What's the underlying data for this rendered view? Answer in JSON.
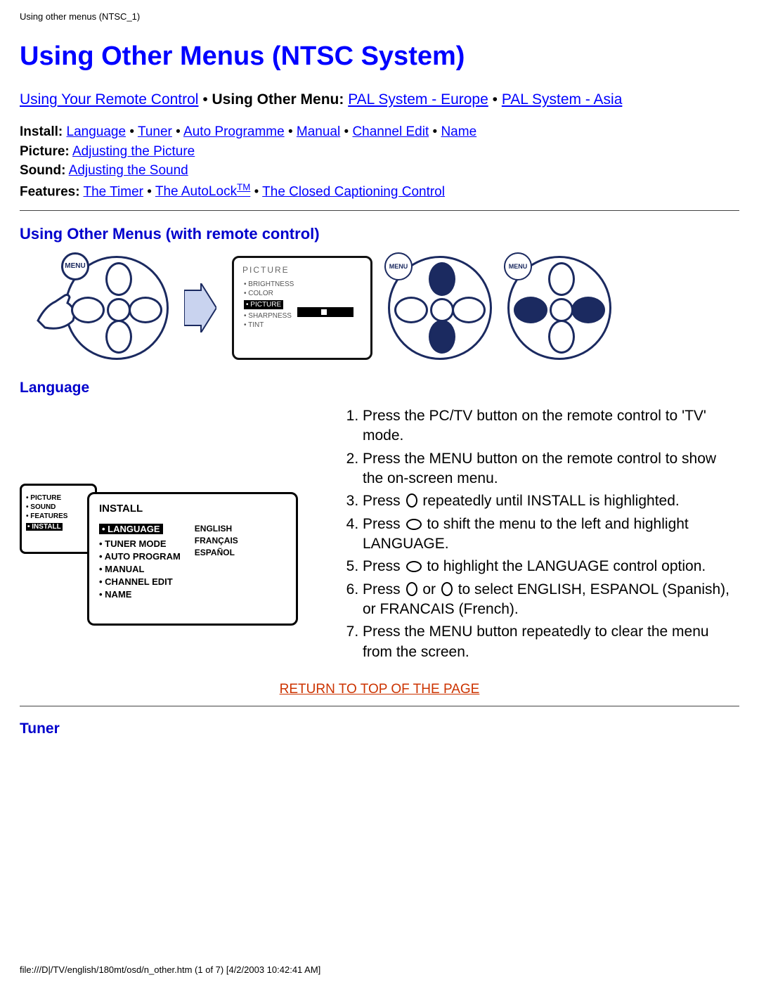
{
  "header_path": "Using other menus (NTSC_1)",
  "title": "Using Other Menus (NTSC System)",
  "topnav": {
    "remote": "Using Your Remote Control",
    "sep": " • ",
    "current_label": "Using Other Menu:",
    "pal_eu": "PAL System - Europe",
    "pal_asia": "PAL System - Asia"
  },
  "subnav": {
    "install_label": "Install:",
    "install_items": [
      "Language",
      "Tuner",
      "Auto Programme",
      "Manual",
      "Channel Edit",
      "Name"
    ],
    "picture_label": "Picture:",
    "picture_link": "Adjusting the Picture",
    "sound_label": "Sound:",
    "sound_link": "Adjusting the Sound",
    "features_label": "Features:",
    "features_timer": "The Timer",
    "features_autolock_pre": "The AutoLock",
    "features_autolock_tm": "TM",
    "features_cc": "The Closed Captioning Control"
  },
  "section_remote": "Using Other Menus (with remote control)",
  "osd": {
    "title": "PICTURE",
    "items": [
      "BRIGHTNESS",
      "COLOR",
      "PICTURE",
      "SHARPNESS",
      "TINT"
    ]
  },
  "menu_badge": "MENU",
  "section_language": "Language",
  "install_panel": {
    "small_items": [
      "PICTURE",
      "SOUND",
      "FEATURES",
      "INSTALL"
    ],
    "title": "INSTALL",
    "col1": [
      "LANGUAGE",
      "TUNER MODE",
      "AUTO PROGRAM",
      "MANUAL",
      "CHANNEL EDIT",
      "NAME"
    ],
    "col2": [
      "ENGLISH",
      "FRANÇAIS",
      "ESPAÑOL"
    ]
  },
  "steps": [
    "Press the PC/TV button on the remote control to 'TV' mode.",
    "Press the MENU button on the remote control to show the on-screen menu.",
    {
      "pre": "Press ",
      "icon": "v",
      "post": " repeatedly until INSTALL is highlighted."
    },
    {
      "pre": "Press ",
      "icon": "h",
      "post": " to shift the menu to the left and highlight LANGUAGE."
    },
    {
      "pre": "Press ",
      "icon": "h",
      "post": " to highlight the LANGUAGE control option."
    },
    {
      "pre": "Press ",
      "icon": "v",
      "mid": " or ",
      "icon2": "v",
      "post": " to select ENGLISH, ESPANOL (Spanish), or FRANCAIS (French)."
    },
    "Press the MENU button repeatedly to clear the menu from the screen."
  ],
  "return_link": "RETURN TO TOP OF THE PAGE",
  "section_tuner": "Tuner",
  "footer": "file:///D|/TV/english/180mt/osd/n_other.htm (1 of 7) [4/2/2003 10:42:41 AM]"
}
